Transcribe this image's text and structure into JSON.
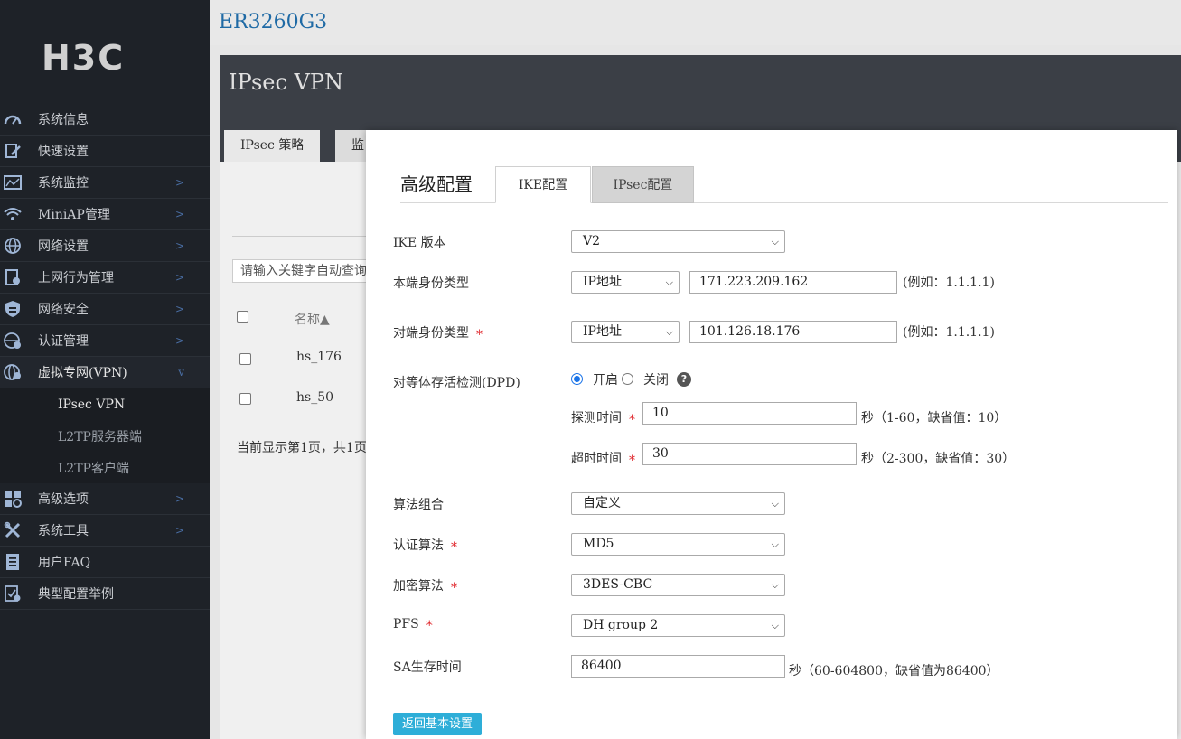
{
  "header": {
    "device": "ER3260G3"
  },
  "logo": "H3C",
  "sidebar": {
    "items": [
      {
        "label": "系统信息",
        "icon": "gauge-icon"
      },
      {
        "label": "快速设置",
        "icon": "edit-icon"
      },
      {
        "label": "系统监控",
        "icon": "monitor-icon",
        "chevron": ">"
      },
      {
        "label": "MiniAP管理",
        "icon": "wifi-icon",
        "chevron": ">"
      },
      {
        "label": "网络设置",
        "icon": "globe-icon",
        "chevron": ">"
      },
      {
        "label": "上网行为管理",
        "icon": "behavior-icon",
        "chevron": ">"
      },
      {
        "label": "网络安全",
        "icon": "shield-icon",
        "chevron": ">"
      },
      {
        "label": "认证管理",
        "icon": "auth-icon",
        "chevron": ">"
      },
      {
        "label": "虚拟专网(VPN)",
        "icon": "vpn-icon",
        "chevron": "v"
      }
    ],
    "sub_items": [
      {
        "label": "IPsec VPN"
      },
      {
        "label": "L2TP服务器端"
      },
      {
        "label": "L2TP客户端"
      }
    ],
    "items_after": [
      {
        "label": "高级选项",
        "icon": "grid-icon",
        "chevron": ">"
      },
      {
        "label": "系统工具",
        "icon": "tools-icon",
        "chevron": ">"
      },
      {
        "label": "用户FAQ",
        "icon": "faq-icon"
      },
      {
        "label": "典型配置举例",
        "icon": "example-icon"
      }
    ]
  },
  "panel": {
    "title": "IPsec VPN",
    "tabs": [
      "IPsec 策略",
      "监"
    ],
    "search_placeholder": "请输入关键字自动查询",
    "col_name": "名称▲",
    "rows": [
      "hs_176",
      "hs_50"
    ],
    "footer": "当前显示第1页，共1页,"
  },
  "modal": {
    "title": "高级配置",
    "tabs": {
      "ike": "IKE配置",
      "ipsec": "IPsec配置"
    },
    "ike_version": {
      "label": "IKE 版本",
      "value": "V2"
    },
    "local_id": {
      "label": "本端身份类型",
      "type": "IP地址",
      "value": "171.223.209.162",
      "hint": "(例如：1.1.1.1)"
    },
    "peer_id": {
      "label": "对端身份类型",
      "required": "*",
      "type": "IP地址",
      "value": "101.126.18.176",
      "hint": "(例如：1.1.1.1)"
    },
    "dpd": {
      "label": "对等体存活检测(DPD)",
      "on_label": "开启",
      "off_label": "关闭",
      "help": "?",
      "detect": {
        "label": "探测时间",
        "required": "*",
        "value": "10",
        "hint": "秒（1-60，缺省值：10）"
      },
      "timeout": {
        "label": "超时时间",
        "required": "*",
        "value": "30",
        "hint": "秒（2-300，缺省值：30）"
      }
    },
    "algo_suite": {
      "label": "算法组合",
      "value": "自定义"
    },
    "auth_algo": {
      "label": "认证算法",
      "required": "*",
      "value": "MD5"
    },
    "enc_algo": {
      "label": "加密算法",
      "required": "*",
      "value": "3DES-CBC"
    },
    "pfs": {
      "label": "PFS",
      "required": "*",
      "value": "DH group 2"
    },
    "sa_lifetime": {
      "label": "SA生存时间",
      "value": "86400",
      "hint": "秒（60-604800，缺省值为86400）"
    },
    "back_button": "返回基本设置"
  },
  "colors": {
    "accent": "#2eaed8",
    "sidebar_bg": "#1e2228",
    "required": "#e0262b",
    "device": "#1f6aa5"
  }
}
